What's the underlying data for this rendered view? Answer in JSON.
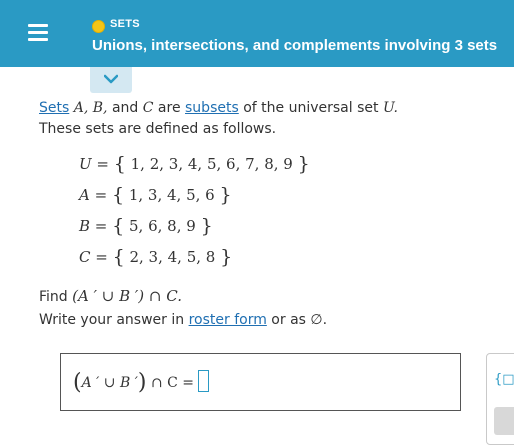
{
  "header": {
    "topic": "SETS",
    "title": "Unions, intersections, and complements involving 3 sets",
    "colors": {
      "bar": "#2a9ac4",
      "dot": "#f5c518"
    }
  },
  "problem": {
    "intro": {
      "sets_link": "Sets",
      "vars": "A, B,",
      "and": "and",
      "c": "C",
      "are": "are",
      "subsets_link": "subsets",
      "rest": "of the universal set",
      "u": "U."
    },
    "intro2": "These sets are defined as follows.",
    "definitions": [
      {
        "name": "U",
        "elements": "1, 2, 3, 4, 5, 6, 7, 8, 9"
      },
      {
        "name": "A",
        "elements": "1, 3, 4, 5, 6"
      },
      {
        "name": "B",
        "elements": "5, 6, 8, 9"
      },
      {
        "name": "C",
        "elements": "2, 3, 4, 5, 8"
      }
    ],
    "find_label": "Find",
    "find_expr": "(A ′ ∪ B ′) ∩ C.",
    "instruction": {
      "prefix": "Write your answer in",
      "link": "roster form",
      "middle": "or as",
      "empty": "∅."
    }
  },
  "answer": {
    "expr_left": "A ′ ∪ B ′",
    "expr_right": "∩ C =",
    "value": ""
  },
  "side_panel": {
    "glyph": "{□"
  }
}
